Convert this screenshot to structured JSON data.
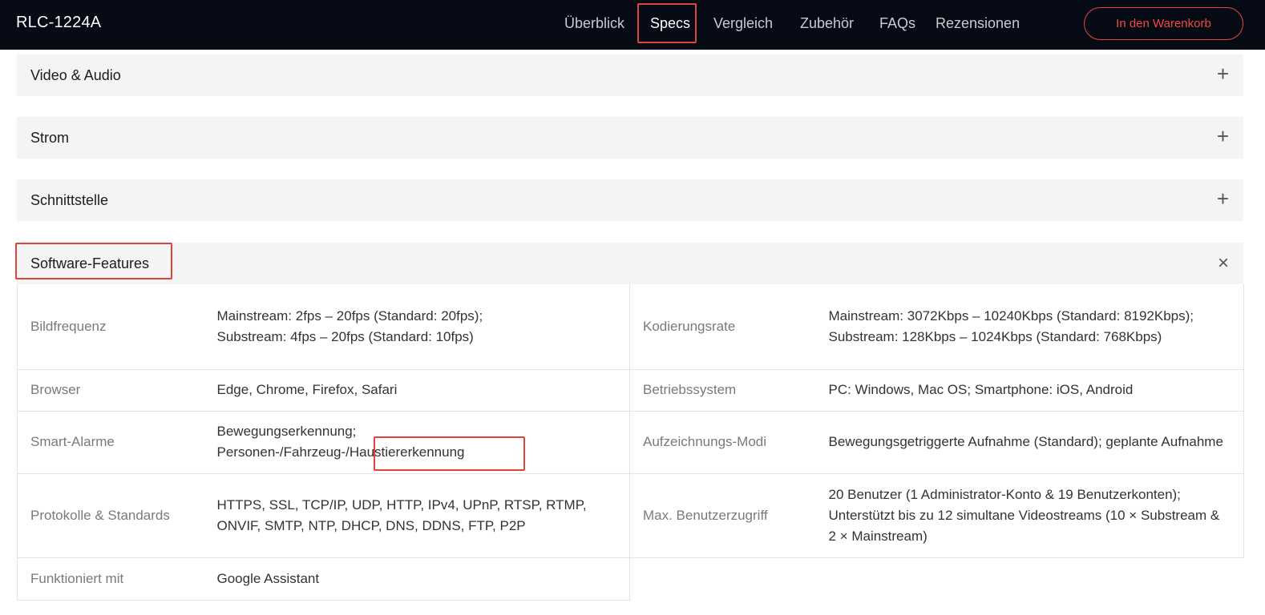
{
  "header": {
    "brand": "RLC-1224A",
    "nav": [
      "Überblick",
      "Specs",
      "Vergleich",
      "Zubehör",
      "FAQs",
      "Rezensionen"
    ],
    "active": "Specs",
    "cart_label": "In den Warenkorb"
  },
  "sections": [
    {
      "title": "Video & Audio",
      "icon": "plus-icon",
      "symbol": "+"
    },
    {
      "title": "Strom",
      "icon": "plus-icon",
      "symbol": "+"
    },
    {
      "title": "Schnittstelle",
      "icon": "plus-icon",
      "symbol": "+"
    },
    {
      "title": "Software-Features",
      "icon": "close-icon",
      "symbol": "×"
    }
  ],
  "specs": [
    {
      "l1": "Bildfrequenz",
      "v1": "Mainstream: 2fps – 20fps (Standard: 20fps);\nSubstream: 4fps – 20fps (Standard: 10fps)",
      "l2": "Kodierungsrate",
      "v2": "Mainstream: 3072Kbps – 10240Kbps (Standard: 8192Kbps);\nSubstream: 128Kbps – 1024Kbps (Standard: 768Kbps)"
    },
    {
      "l1": "Browser",
      "v1": "Edge, Chrome, Firefox, Safari",
      "l2": "Betriebssystem",
      "v2": "PC: Windows, Mac OS; Smartphone: iOS, Android"
    },
    {
      "l1": "Smart-Alarme",
      "v1": "Bewegungserkennung;\nPersonen-/Fahrzeug-/Haustiererkennung",
      "l2": "Aufzeichnungs-Modi",
      "v2": "Bewegungsgetriggerte Aufnahme (Standard); geplante Aufnahme"
    },
    {
      "l1": "Protokolle & Standards",
      "v1": "HTTPS, SSL, TCP/IP, UDP, HTTP, IPv4, UPnP, RTSP, RTMP, ONVIF, SMTP, NTP, DHCP, DNS, DDNS, FTP, P2P",
      "l2": "Max. Benutzerzugriff",
      "v2": "20 Benutzer (1 Administrator-Konto & 19 Benutzerkonten); Unterstützt bis zu 12 simultane Videostreams (10 × Substream & 2 × Mainstream)"
    },
    {
      "l1": "Funktioniert mit",
      "v1": "Google Assistant",
      "l2": "",
      "v2": ""
    }
  ],
  "accent_color": "#e0423a"
}
